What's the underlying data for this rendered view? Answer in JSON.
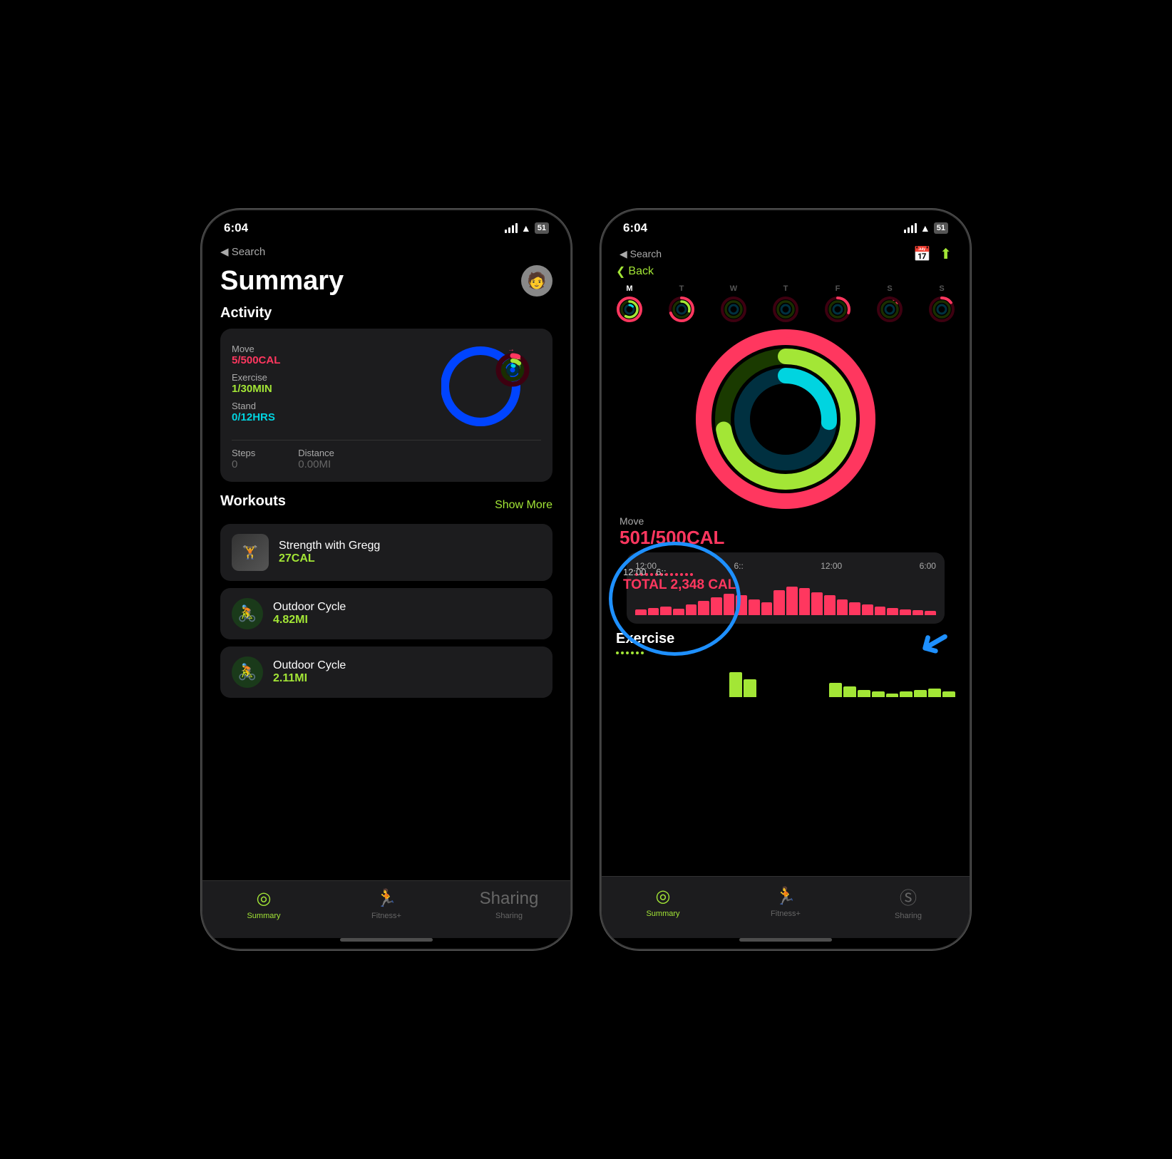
{
  "phone1": {
    "status": {
      "time": "6:04",
      "back_label": "◀ Search"
    },
    "summary_title": "Summary",
    "avatar_emoji": "🧑",
    "activity": {
      "section_label": "Activity",
      "move_label": "Move",
      "move_value": "5/500CAL",
      "exercise_label": "Exercise",
      "exercise_value": "1/30MIN",
      "stand_label": "Stand",
      "stand_value": "0/12HRS",
      "steps_label": "Steps",
      "steps_value": "0",
      "distance_label": "Distance",
      "distance_value": "0.00MI"
    },
    "workouts": {
      "section_label": "Workouts",
      "show_more_label": "Show More",
      "items": [
        {
          "name": "Strength with Gregg",
          "value": "27CAL",
          "type": "image"
        },
        {
          "name": "Outdoor Cycle",
          "value": "4.82MI",
          "type": "bike"
        },
        {
          "name": "Outdoor Cycle",
          "value": "2.11MI",
          "type": "bike"
        }
      ]
    },
    "tabs": [
      {
        "label": "Summary",
        "icon": "◎",
        "active": true
      },
      {
        "label": "Fitness+",
        "icon": "🏃",
        "active": false
      },
      {
        "label": "Sharing",
        "icon": "Ⓢ",
        "active": false
      }
    ]
  },
  "phone2": {
    "status": {
      "time": "6:04",
      "back_label": "◀ Search"
    },
    "nav": {
      "back_label": "Back",
      "calendar_icon": "📅",
      "share_icon": "⬆"
    },
    "week_days": [
      "M",
      "T",
      "W",
      "T",
      "F",
      "S",
      "S"
    ],
    "active_day_index": 0,
    "rings": {
      "move_label": "Move",
      "move_value": "501/500CAL"
    },
    "chart": {
      "time_start": "12:00",
      "time_end": "6::",
      "right_time_start": "12:00",
      "right_time_end": "6:00",
      "tooltip": {
        "time": "12:00        6::",
        "total_label": "TOTAL 2,348 CAL"
      }
    },
    "exercise_label": "Exercise",
    "tabs": [
      {
        "label": "Summary",
        "icon": "◎",
        "active": true
      },
      {
        "label": "Fitness+",
        "icon": "🏃",
        "active": false
      },
      {
        "label": "Sharing",
        "icon": "Ⓢ",
        "active": false
      }
    ],
    "bar_heights_move": [
      8,
      10,
      12,
      9,
      15,
      20,
      25,
      30,
      28,
      22,
      18,
      35,
      40,
      38,
      32,
      28,
      22,
      18,
      15,
      12,
      10,
      8,
      7,
      6
    ],
    "bar_heights_exercise": [
      0,
      0,
      0,
      0,
      0,
      0,
      0,
      0,
      35,
      25,
      0,
      0,
      0,
      0,
      0,
      20,
      15,
      10,
      8,
      5,
      8,
      10,
      12,
      8
    ]
  }
}
